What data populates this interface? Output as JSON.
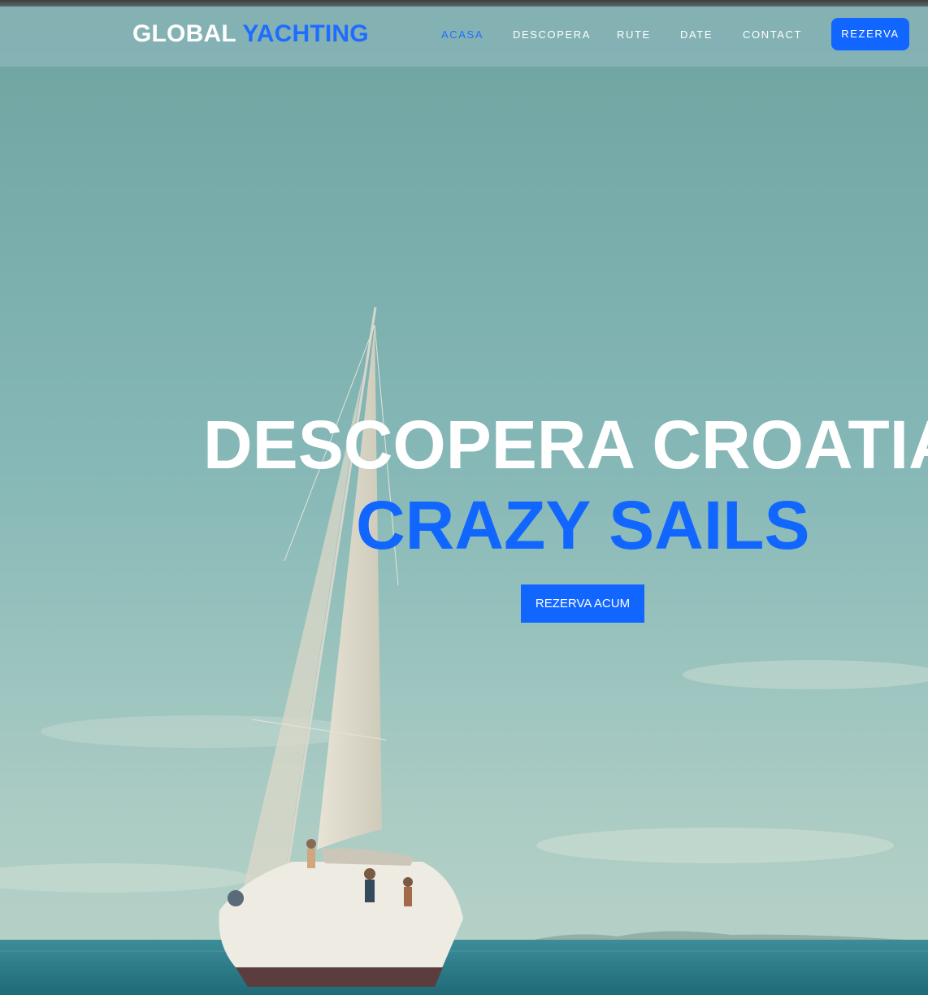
{
  "brand": {
    "part1": "GLOBAL",
    "part2": "YACHTING"
  },
  "nav": {
    "items": [
      {
        "label": "ACASA",
        "active": true
      },
      {
        "label": "DESCOPERA",
        "active": false
      },
      {
        "label": "RUTE",
        "active": false
      },
      {
        "label": "DATE",
        "active": false
      },
      {
        "label": "CONTACT",
        "active": false
      }
    ],
    "cta_label": "REZERVA"
  },
  "hero": {
    "headline": "DESCOPERA CROATIA",
    "subheadline": "CRAZY SAILS",
    "cta_label": "REZERVA ACUM"
  },
  "colors": {
    "accent": "#1166ff",
    "nav_bg": "#96bec3",
    "sky": "#7fb0ad",
    "sea": "#2f7f8a"
  }
}
